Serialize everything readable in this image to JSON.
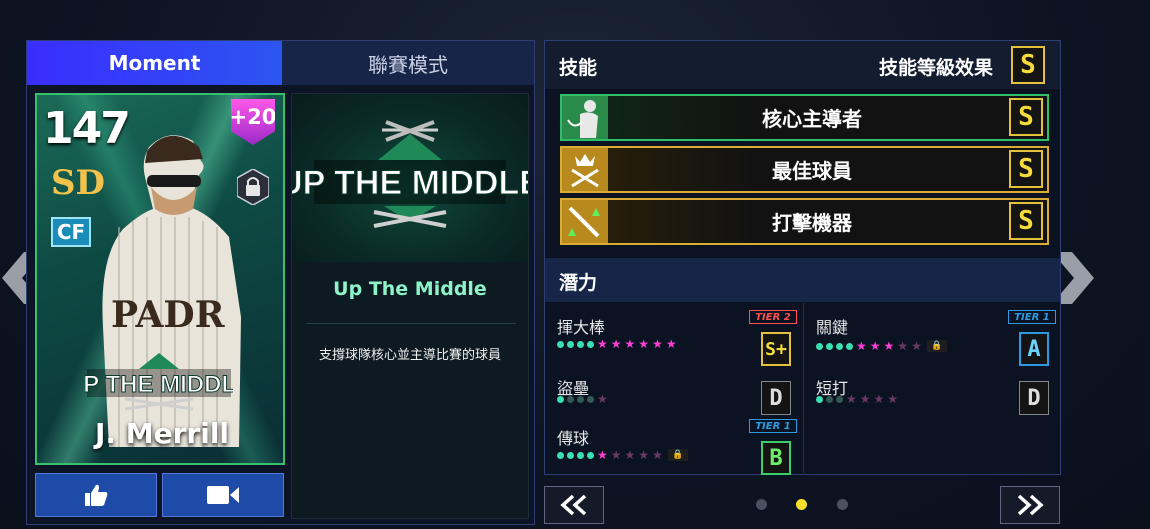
{
  "tabs": {
    "active": "Moment",
    "inactive": "聯賽模式"
  },
  "card": {
    "ovr": "147",
    "boost": "+20",
    "position": "CF",
    "team_logo": "SD",
    "name": "J. Merrill",
    "badge_text": "UP THE MIDDLE"
  },
  "buttons": {
    "like_icon": "thumbs-up-icon",
    "video_icon": "video-camera-icon"
  },
  "skin": {
    "art_text": "UP THE MIDDLE",
    "title": "Up The Middle",
    "description": "支撐球隊核心並主導比賽的球員"
  },
  "skills": {
    "title": "技能",
    "level_label": "技能等級效果",
    "level_grade": "S",
    "items": [
      {
        "name": "核心主導者",
        "grade": "S",
        "style": "green",
        "icon": "pitcher-player-icon"
      },
      {
        "name": "最佳球員",
        "grade": "S",
        "style": "gold",
        "icon": "crown-bats-icon"
      },
      {
        "name": "打擊機器",
        "grade": "S",
        "style": "gold",
        "icon": "bat-arrows-icon"
      }
    ]
  },
  "potential": {
    "title": "潛力",
    "items": [
      {
        "label": "揮大棒",
        "grade": "S+",
        "tier": "TIER 2"
      },
      {
        "label": "關鍵",
        "grade": "A",
        "tier": "TIER 1"
      },
      {
        "label": "盜壘",
        "grade": "D",
        "tier": ""
      },
      {
        "label": "短打",
        "grade": "D",
        "tier": ""
      },
      {
        "label": "傳球",
        "grade": "B",
        "tier": "TIER 1"
      }
    ]
  },
  "pager": {
    "prev_icon": "double-chevron-left-icon",
    "next_icon": "double-chevron-right-icon",
    "pages": 3,
    "active_page": 2
  },
  "colors": {
    "accent_green": "#35c26a",
    "accent_gold": "#e4c13c",
    "tab_active": "#3a2dff",
    "star_pink": "#ff3fd2",
    "dot_teal": "#3be0b0"
  }
}
